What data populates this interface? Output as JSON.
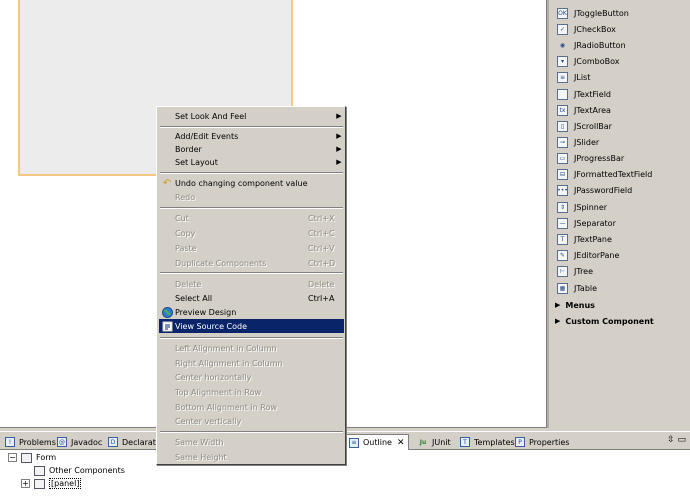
{
  "palette": {
    "items": [
      {
        "label": "JToggleButton",
        "icon": "toggle-button-icon"
      },
      {
        "label": "JCheckBox",
        "icon": "checkbox-icon"
      },
      {
        "label": "JRadioButton",
        "icon": "radio-button-icon"
      },
      {
        "label": "JComboBox",
        "icon": "combobox-icon"
      },
      {
        "label": "JList",
        "icon": "list-icon"
      },
      {
        "label": "JTextField",
        "icon": "text-field-icon"
      },
      {
        "label": "JTextArea",
        "icon": "text-area-icon"
      },
      {
        "label": "JScrollBar",
        "icon": "scrollbar-icon"
      },
      {
        "label": "JSlider",
        "icon": "slider-icon"
      },
      {
        "label": "JProgressBar",
        "icon": "progress-bar-icon"
      },
      {
        "label": "JFormattedTextField",
        "icon": "formatted-text-field-icon"
      },
      {
        "label": "JPasswordField",
        "icon": "password-field-icon"
      },
      {
        "label": "JSpinner",
        "icon": "spinner-icon"
      },
      {
        "label": "JSeparator",
        "icon": "separator-icon"
      },
      {
        "label": "JTextPane",
        "icon": "text-pane-icon"
      },
      {
        "label": "JEditorPane",
        "icon": "editor-pane-icon"
      },
      {
        "label": "JTree",
        "icon": "tree-icon"
      },
      {
        "label": "JTable",
        "icon": "table-icon"
      }
    ],
    "sections": [
      "Menus",
      "Custom Component"
    ]
  },
  "menu": {
    "set_look_and_feel": "Set Look And Feel",
    "add_edit_events": "Add/Edit Events",
    "border": "Border",
    "set_layout": "Set Layout",
    "undo": "Undo changing component value",
    "redo": "Redo",
    "cut": "Cut",
    "cut_sc": "Ctrl+X",
    "copy": "Copy",
    "copy_sc": "Ctrl+C",
    "paste": "Paste",
    "paste_sc": "Ctrl+V",
    "duplicate": "Duplicate Components",
    "duplicate_sc": "Ctrl+D",
    "delete": "Delete",
    "delete_sc": "Delete",
    "select_all": "Select All",
    "select_all_sc": "Ctrl+A",
    "preview_design": "Preview Design",
    "view_source": "View Source Code",
    "left_align": "Left Alignment in Column",
    "right_align": "Right Alignment in Column",
    "center_h": "Center horizontally",
    "top_align": "Top Alignment in Row",
    "bottom_align": "Bottom Alignment in Row",
    "center_v": "Center vertically",
    "same_width": "Same Width",
    "same_height": "Same Height"
  },
  "tabs": {
    "problems": "Problems",
    "javadoc": "Javadoc",
    "declaration": "Declaratio",
    "outline": "Outline",
    "junit": "JUnit",
    "templates": "Templates",
    "properties": "Properties"
  },
  "outline": {
    "form": "Form",
    "other_components": "Other Components",
    "panel": "[panel]"
  }
}
